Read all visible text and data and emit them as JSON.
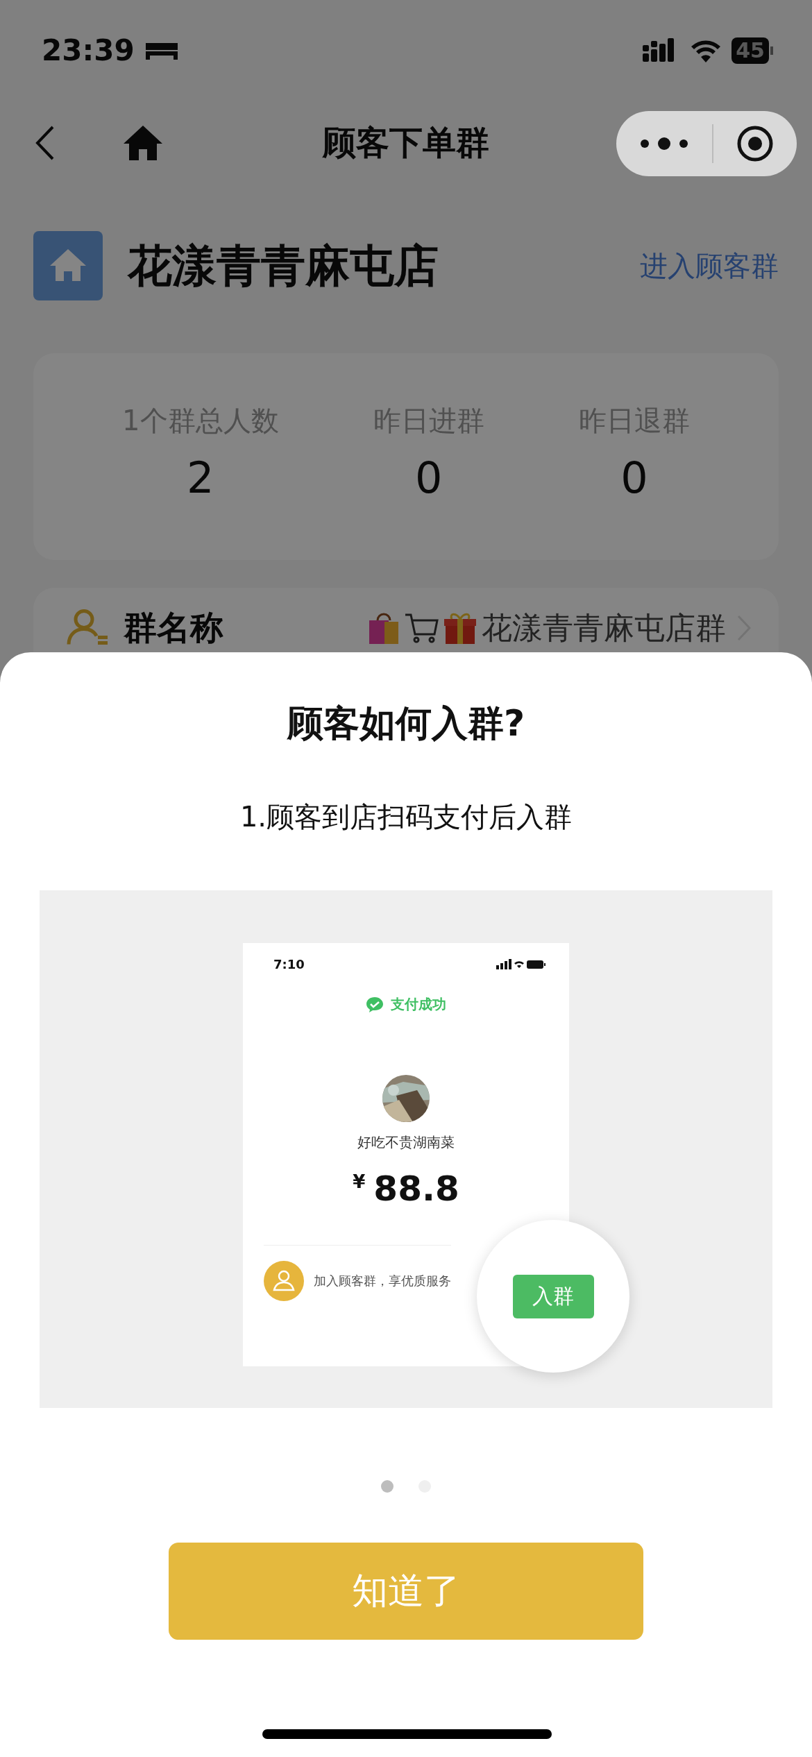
{
  "status_bar": {
    "time": "23:39",
    "battery": "45"
  },
  "nav": {
    "title": "顾客下单群"
  },
  "store": {
    "name": "花漾青青麻屯店",
    "link": "进入顾客群"
  },
  "stats": [
    {
      "label": "1个群总人数",
      "value": "2"
    },
    {
      "label": "昨日进群",
      "value": "0"
    },
    {
      "label": "昨日退群",
      "value": "0"
    }
  ],
  "group_row": {
    "label": "群名称",
    "value": "花漾青青麻屯店群"
  },
  "sheet": {
    "title": "顾客如何入群?",
    "step": "1.顾客到店扫码支付后入群",
    "example": {
      "time": "7:10",
      "status": "支付成功",
      "merchant": "好吃不贵湖南菜",
      "currency": "¥",
      "amount": "88.8",
      "prompt": "加入顾客群，享优质服务",
      "join_button": "入群"
    },
    "pages": [
      {
        "selected": true
      },
      {
        "selected": false
      }
    ],
    "button": "知道了"
  }
}
